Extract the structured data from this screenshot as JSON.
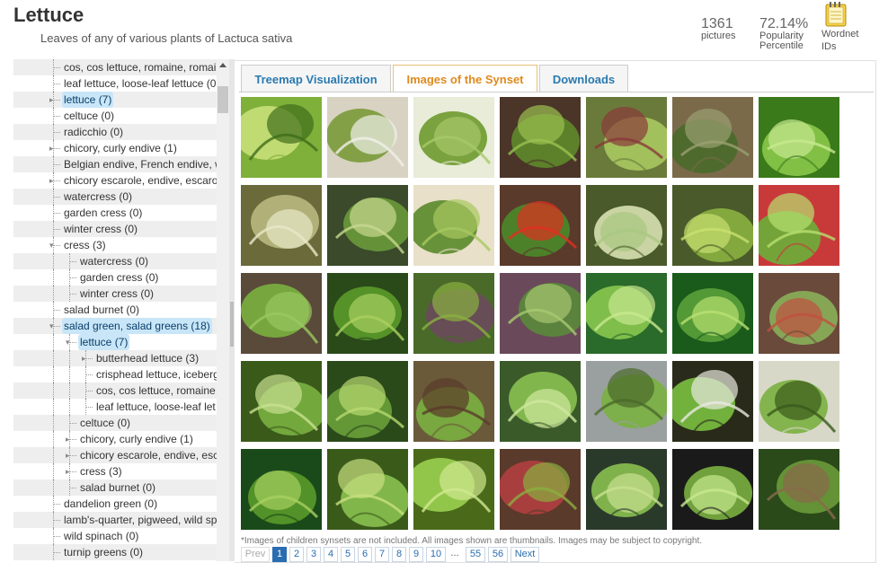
{
  "header": {
    "title": "Lettuce",
    "subtitle": "Leaves of any of various plants of Lactuca sativa",
    "pictures_count": "1361",
    "pictures_label": "pictures",
    "popularity_value": "72.14%",
    "popularity_label_1": "Popularity",
    "popularity_label_2": "Percentile",
    "wordnet_label_1": "Wordnet",
    "wordnet_label_2": "IDs"
  },
  "tree": [
    {
      "label": "cos, cos lettuce, romaine, romai",
      "depth": 0
    },
    {
      "label": "leaf lettuce, loose-leaf lettuce (0",
      "depth": 0
    },
    {
      "label": "lettuce (7)",
      "depth": 0,
      "expander": "plus",
      "selected": true
    },
    {
      "label": "celtuce (0)",
      "depth": 0
    },
    {
      "label": "radicchio (0)",
      "depth": 0
    },
    {
      "label": "chicory, curly endive (1)",
      "depth": 0,
      "expander": "plus"
    },
    {
      "label": "Belgian endive, French endive, w",
      "depth": 0
    },
    {
      "label": "chicory escarole, endive, escaro",
      "depth": 0,
      "expander": "plus"
    },
    {
      "label": "watercress (0)",
      "depth": 0
    },
    {
      "label": "garden cress (0)",
      "depth": 0
    },
    {
      "label": "winter cress (0)",
      "depth": 0
    },
    {
      "label": "cress (3)",
      "depth": 0,
      "expander": "minus"
    },
    {
      "label": "watercress (0)",
      "depth": 1
    },
    {
      "label": "garden cress (0)",
      "depth": 1
    },
    {
      "label": "winter cress (0)",
      "depth": 1
    },
    {
      "label": "salad burnet (0)",
      "depth": 0
    },
    {
      "label": "salad green, salad greens (18)",
      "depth": 0,
      "expander": "minus",
      "selected": true
    },
    {
      "label": "lettuce (7)",
      "depth": 1,
      "expander": "minus",
      "selected": true
    },
    {
      "label": "butterhead lettuce (3)",
      "depth": 2,
      "expander": "plus"
    },
    {
      "label": "crisphead lettuce, iceberg",
      "depth": 2
    },
    {
      "label": "cos, cos lettuce, romaine",
      "depth": 2
    },
    {
      "label": "leaf lettuce, loose-leaf let",
      "depth": 2
    },
    {
      "label": "celtuce (0)",
      "depth": 1
    },
    {
      "label": "chicory, curly endive (1)",
      "depth": 1,
      "expander": "plus"
    },
    {
      "label": "chicory escarole, endive, esc",
      "depth": 1,
      "expander": "plus"
    },
    {
      "label": "cress (3)",
      "depth": 1,
      "expander": "plus"
    },
    {
      "label": "salad burnet (0)",
      "depth": 1
    },
    {
      "label": "dandelion green (0)",
      "depth": 0
    },
    {
      "label": "lamb's-quarter, pigweed, wild sp",
      "depth": 0
    },
    {
      "label": "wild spinach (0)",
      "depth": 0
    },
    {
      "label": "turnip greens (0)",
      "depth": 0
    }
  ],
  "tabs": [
    {
      "label": "Treemap Visualization",
      "active": false
    },
    {
      "label": "Images of the Synset",
      "active": true
    },
    {
      "label": "Downloads",
      "active": false
    }
  ],
  "thumbnails": [
    {
      "bg": "#7fb03a",
      "fg": "#c9e07a",
      "accent": "#3f6e1a"
    },
    {
      "bg": "#d8d2c2",
      "fg": "#7a9a3a",
      "accent": "#f0f0ea"
    },
    {
      "bg": "#e8ecd8",
      "fg": "#6e9a2e",
      "accent": "#a8c86a"
    },
    {
      "bg": "#4a3528",
      "fg": "#5e8a2a",
      "accent": "#9ac050"
    },
    {
      "bg": "#6a7a3a",
      "fg": "#a8c860",
      "accent": "#8a3a3a"
    },
    {
      "bg": "#7a6a4a",
      "fg": "#4a6a2a",
      "accent": "#9aa070"
    },
    {
      "bg": "#3a7a1a",
      "fg": "#8ac84a",
      "accent": "#c8e890"
    },
    {
      "bg": "#6a6a3a",
      "fg": "#b8b880",
      "accent": "#e8e8c8"
    },
    {
      "bg": "#3a4a2a",
      "fg": "#6a9a3a",
      "accent": "#c8d890"
    },
    {
      "bg": "#e8e0c8",
      "fg": "#5a8a2a",
      "accent": "#a8c860"
    },
    {
      "bg": "#5a3a2a",
      "fg": "#4a8a2a",
      "accent": "#e03020"
    },
    {
      "bg": "#4a5a2a",
      "fg": "#d8e0b0",
      "accent": "#a8c880"
    },
    {
      "bg": "#4a5a2a",
      "fg": "#8ab040",
      "accent": "#c8e070"
    },
    {
      "bg": "#c83a3a",
      "fg": "#6ab03a",
      "accent": "#b8e070"
    },
    {
      "bg": "#5a4a3a",
      "fg": "#7ab040",
      "accent": "#9ac860"
    },
    {
      "bg": "#2a4a1a",
      "fg": "#5a9a2a",
      "accent": "#aad060"
    },
    {
      "bg": "#4a6a2a",
      "fg": "#6a4a5a",
      "accent": "#8ab040"
    },
    {
      "bg": "#6a4a5a",
      "fg": "#5a8a3a",
      "accent": "#a8c870"
    },
    {
      "bg": "#2a6a2a",
      "fg": "#8ac850",
      "accent": "#c8e890"
    },
    {
      "bg": "#1a5a1a",
      "fg": "#5aa03a",
      "accent": "#b8e070"
    },
    {
      "bg": "#6a4a3a",
      "fg": "#8ab05a",
      "accent": "#c05040"
    },
    {
      "bg": "#3a5a1a",
      "fg": "#7ab040",
      "accent": "#c8e090"
    },
    {
      "bg": "#2a4a1a",
      "fg": "#6aa03a",
      "accent": "#b8d870"
    },
    {
      "bg": "#6a5a3a",
      "fg": "#7ab040",
      "accent": "#5a3a2a"
    },
    {
      "bg": "#3a5a2a",
      "fg": "#8ac050",
      "accent": "#d0e8a0"
    },
    {
      "bg": "#9aa0a0",
      "fg": "#7ab040",
      "accent": "#4a6a2a"
    },
    {
      "bg": "#2a2a1a",
      "fg": "#7ac040",
      "accent": "#e8e8e0"
    },
    {
      "bg": "#d8d8c8",
      "fg": "#7ab040",
      "accent": "#3a5a1a"
    },
    {
      "bg": "#1a4a1a",
      "fg": "#5a9a2a",
      "accent": "#a8d060"
    },
    {
      "bg": "#3a5a1a",
      "fg": "#8ac050",
      "accent": "#c8e080"
    },
    {
      "bg": "#4a6a1a",
      "fg": "#9ad050",
      "accent": "#d0e890"
    },
    {
      "bg": "#5a3a2a",
      "fg": "#b04040",
      "accent": "#8ab040"
    },
    {
      "bg": "#2a3a2a",
      "fg": "#8ac050",
      "accent": "#c8e090"
    },
    {
      "bg": "#1a1a1a",
      "fg": "#7ab040",
      "accent": "#c8e890"
    },
    {
      "bg": "#2a4a1a",
      "fg": "#6a9a3a",
      "accent": "#8a6a4a"
    }
  ],
  "footer": {
    "note": "*Images of children synsets are not included. All images shown are thumbnails. Images may be subject to copyright.",
    "pager": {
      "prev": "Prev",
      "pages": [
        "1",
        "2",
        "3",
        "4",
        "5",
        "6",
        "7",
        "8",
        "9",
        "10"
      ],
      "current": "1",
      "ellipsis": "...",
      "tail": [
        "55",
        "56"
      ],
      "next": "Next"
    }
  }
}
